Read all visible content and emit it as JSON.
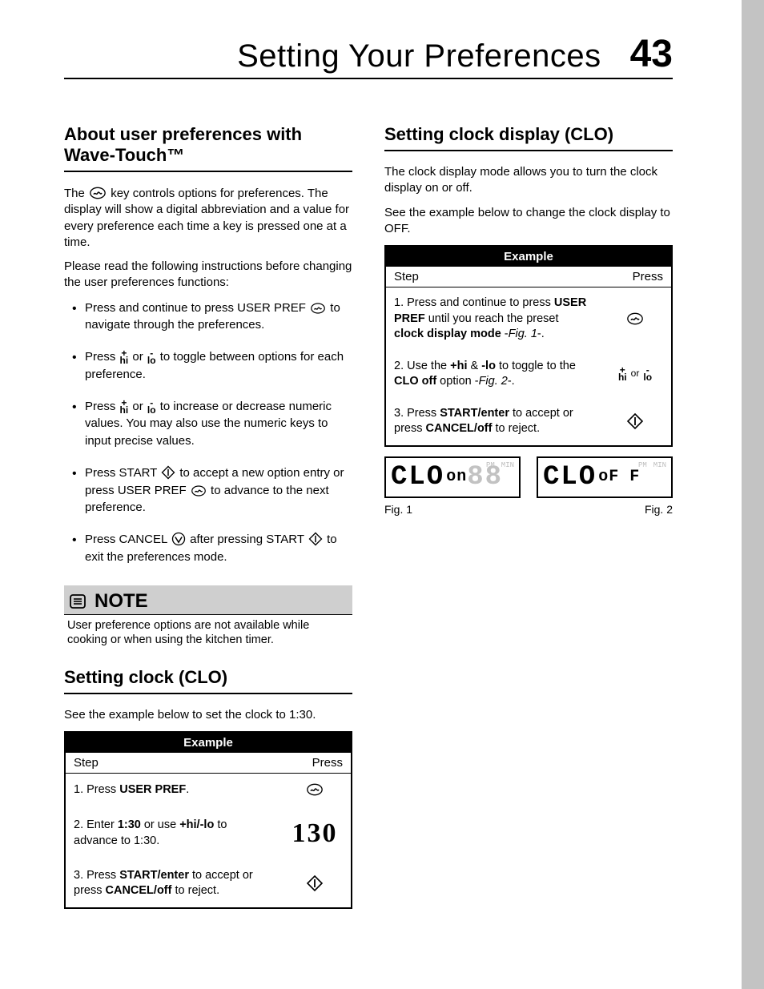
{
  "header": {
    "title": "Setting Your Preferences",
    "page_number": "43"
  },
  "left": {
    "sec1_title": "About user preferences with Wave-Touch™",
    "intro_pre": "The ",
    "intro_post": " key controls options for preferences. The display will show a digital abbreviation and a value for every preference each time a key is pressed one at a time.",
    "before_list": "Please read the following instructions before changing the user preferences functions:",
    "b1_a": "Press and continue to press USER PREF ",
    "b1_b": " to navigate through the preferences.",
    "b2_a": "Press ",
    "b2_mid": " or ",
    "b2_b": " to toggle between options for each preference.",
    "b3_a": "Press ",
    "b3_mid": " or ",
    "b3_b": " to increase or decrease numeric values. You may also use the numeric keys to input precise values.",
    "b4_a": "Press START ",
    "b4_b": " to accept a new option entry or press USER PREF ",
    "b4_c": " to advance to the next preference.",
    "b5_a": "Press CANCEL ",
    "b5_b": " after pressing START ",
    "b5_c": " to exit the preferences mode.",
    "note_label": "NOTE",
    "note_body": "User preference options are not available while cooking or when using the kitchen timer.",
    "sec2_title": "Setting clock (CLO)",
    "clock_intro": "See the example below to set the clock to 1:30.",
    "table": {
      "example_label": "Example",
      "step_label": "Step",
      "press_label": "Press",
      "row1_a": "1. Press ",
      "row1_b": "USER PREF",
      "row1_c": ".",
      "row2_a": "2. Enter ",
      "row2_b": "1:30",
      "row2_c": " or use ",
      "row2_d": "+hi/-lo",
      "row2_e": " to advance to 1:30.",
      "row2_press": "130",
      "row3_a": "3. Press ",
      "row3_b": "START/enter",
      "row3_c": " to accept or press ",
      "row3_d": "CANCEL/off",
      "row3_e": " to reject."
    }
  },
  "right": {
    "sec_title": "Setting clock display (CLO)",
    "p1": "The clock display mode allows you to turn the clock display on or off.",
    "p2": "See the example below to change the clock display to OFF.",
    "table": {
      "example_label": "Example",
      "step_label": "Step",
      "press_label": "Press",
      "r1_a": "1. Press and continue to press ",
      "r1_b": "USER PREF",
      "r1_c": " until you reach the preset ",
      "r1_d": "clock display mode",
      "r1_e": " -",
      "r1_f": "Fig. 1",
      "r1_g": "-.",
      "r2_a": "2. Use the ",
      "r2_b": "+hi",
      "r2_c": " & ",
      "r2_d": "-lo",
      "r2_e": " to toggle to the ",
      "r2_f": "CLO off",
      "r2_g": " option  -",
      "r2_h": "Fig. 2",
      "r2_i": "-.",
      "r2_press_mid": "or",
      "r3_a": "3. Press ",
      "r3_b": "START/enter",
      "r3_c": " to accept or press ",
      "r3_d": "CANCEL/off",
      "r3_e": " to reject."
    },
    "lcd1a": "CLO",
    "lcd1b": "on",
    "lcd1ghost": "88",
    "lcd1tiny1": "PM",
    "lcd1tiny2": "MIN",
    "lcd2a": "CLO",
    "lcd2b": "oF F",
    "lcd2tiny1": "PM",
    "lcd2tiny2": "MIN",
    "fig1": "Fig. 1",
    "fig2": "Fig. 2"
  },
  "hl": {
    "plus": "+",
    "hi": "hi",
    "minus": "-",
    "lo": "lo"
  }
}
